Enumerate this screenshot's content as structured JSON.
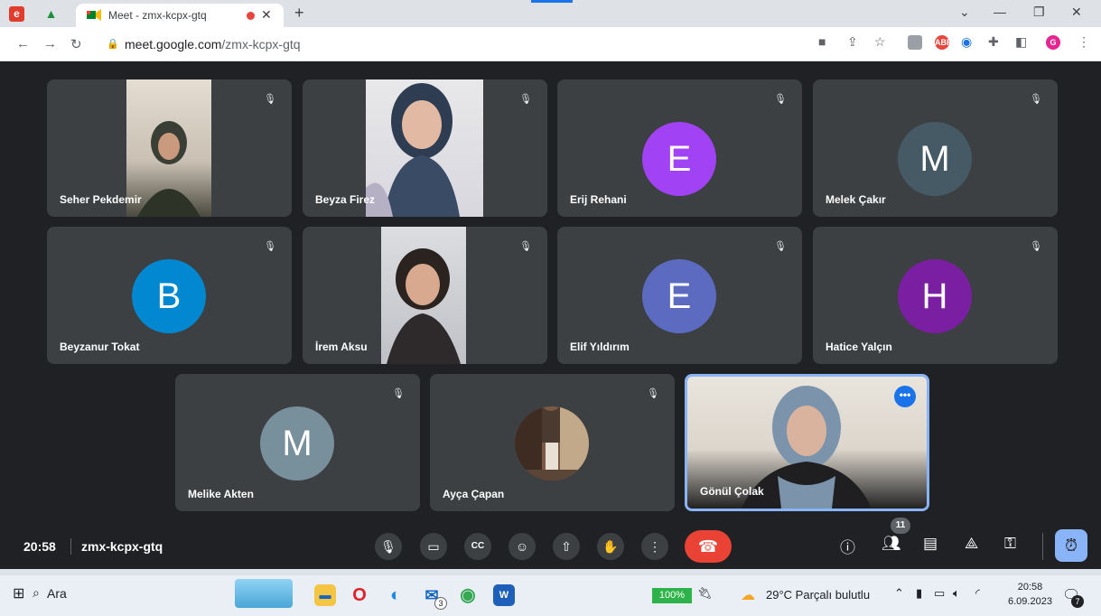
{
  "browser": {
    "tab_title": "Meet - zmx-kcpx-gtq",
    "new_tab_icon": "+",
    "url_host": "meet.google.com",
    "url_path": "/zmx-kcpx-gtq"
  },
  "meeting": {
    "time": "20:58",
    "code": "zmx-kcpx-gtq",
    "participant_count": "11"
  },
  "participants": [
    {
      "name": "Seher Pekdemir",
      "type": "video",
      "muted": true
    },
    {
      "name": "Beyza Firez",
      "type": "video",
      "muted": true
    },
    {
      "name": "Erij Rehani",
      "type": "avatar",
      "initial": "E",
      "color": "#a142f4",
      "muted": true
    },
    {
      "name": "Melek Çakır",
      "type": "avatar",
      "initial": "M",
      "color": "#455a64",
      "muted": true
    },
    {
      "name": "Beyzanur Tokat",
      "type": "avatar",
      "initial": "B",
      "color": "#0288d1",
      "muted": true
    },
    {
      "name": "İrem Aksu",
      "type": "video",
      "muted": true
    },
    {
      "name": "Elif Yıldırım",
      "type": "avatar",
      "initial": "E",
      "color": "#5c6bc0",
      "muted": true
    },
    {
      "name": "Hatice Yalçın",
      "type": "avatar",
      "initial": "H",
      "color": "#7b1fa2",
      "muted": true
    },
    {
      "name": "Melike Akten",
      "type": "avatar",
      "initial": "M",
      "color": "#78909c",
      "muted": true
    },
    {
      "name": "Ayça Çapan",
      "type": "photo",
      "muted": true
    },
    {
      "name": "Gönül Çolak",
      "type": "video",
      "active": true
    }
  ],
  "taskbar": {
    "search_label": "Ara",
    "notification_badge": "3",
    "battery": "100%",
    "temperature": "29°C",
    "weather_desc": "Parçalı bulutlu",
    "time": "20:58",
    "date": "6.09.2023",
    "notif_count": "7"
  },
  "colors": {
    "meet_bg": "#202124",
    "tile_bg": "#3c4043",
    "end_call": "#ea4335",
    "accent": "#8ab4f8"
  }
}
